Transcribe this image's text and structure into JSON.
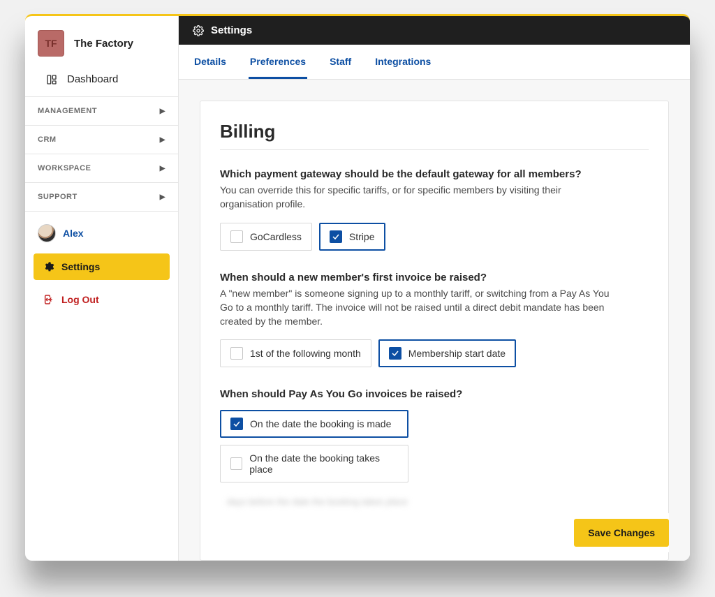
{
  "brand": {
    "initials": "TF",
    "name": "The Factory"
  },
  "sidebar": {
    "dashboard_label": "Dashboard",
    "sections": [
      {
        "label": "MANAGEMENT"
      },
      {
        "label": "CRM"
      },
      {
        "label": "WORKSPACE"
      },
      {
        "label": "SUPPORT"
      }
    ],
    "user_name": "Alex",
    "settings_label": "Settings",
    "logout_label": "Log Out"
  },
  "header": {
    "title": "Settings"
  },
  "tabs": [
    {
      "label": "Details",
      "active": false
    },
    {
      "label": "Preferences",
      "active": true
    },
    {
      "label": "Staff",
      "active": false
    },
    {
      "label": "Integrations",
      "active": false
    }
  ],
  "billing": {
    "heading": "Billing",
    "q1": {
      "title": "Which payment gateway should be the default gateway for all members?",
      "desc": "You can override this for specific tariffs, or for specific members by visiting their organisation profile.",
      "options": [
        {
          "label": "GoCardless",
          "selected": false
        },
        {
          "label": "Stripe",
          "selected": true
        }
      ]
    },
    "q2": {
      "title": "When should a new member's first invoice be raised?",
      "desc": "A \"new member\" is someone signing up to a monthly tariff, or switching from a Pay As You Go to a monthly tariff. The invoice will not be raised until a direct debit mandate has been created by the member.",
      "options": [
        {
          "label": "1st of the following month",
          "selected": false
        },
        {
          "label": "Membership start date",
          "selected": true
        }
      ]
    },
    "q3": {
      "title": "When should Pay As You Go invoices be raised?",
      "options": [
        {
          "label": "On the date the booking is made",
          "selected": true
        },
        {
          "label": "On the date the booking takes place",
          "selected": false
        }
      ],
      "blurred_hint": "days   before        the date the booking takes place"
    }
  },
  "save_label": "Save Changes"
}
